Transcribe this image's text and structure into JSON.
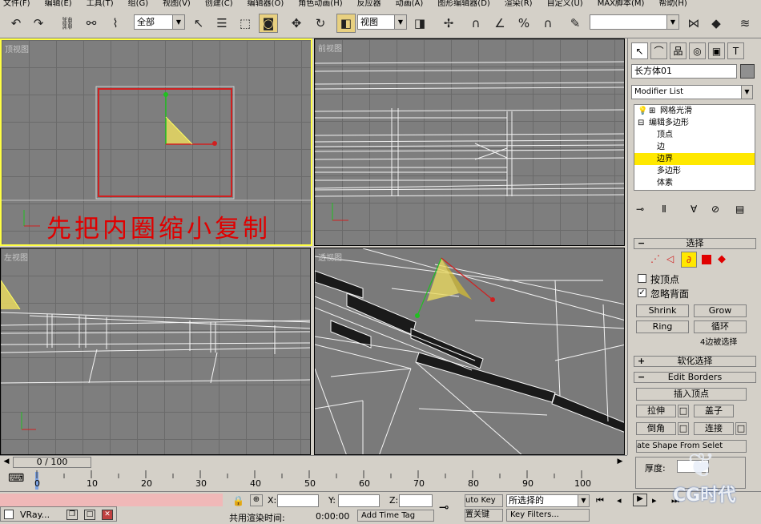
{
  "menu": [
    "文件(F)",
    "编辑(E)",
    "工具(T)",
    "组(G)",
    "视图(V)",
    "创建(C)",
    "编辑器(O)",
    "角色动画(H)",
    "反应器",
    "动画(A)",
    "图形编辑器(D)",
    "渲染(R)",
    "自定义(U)",
    "MAX脚本(M)",
    "帮助(H)"
  ],
  "toolbar": {
    "selection_filter": "全部",
    "ref_coord": "视图",
    "named_selection": ""
  },
  "viewports": {
    "top": {
      "label": "顶视图",
      "annotation": "先把内圈缩小复制"
    },
    "front": {
      "label": "前视图"
    },
    "left": {
      "label": "左视图"
    },
    "persp": {
      "label": "透视图"
    }
  },
  "command_panel": {
    "object_name": "长方体01",
    "modifier_list": "Modifier List",
    "stack": [
      "网格光滑",
      "编辑多边形",
      "顶点",
      "边",
      "边界",
      "多边形",
      "体素"
    ],
    "selection_rollout": "选择",
    "by_vertex": "按顶点",
    "ignore_backfacing": "忽略背面",
    "shrink": "Shrink",
    "grow": "Grow",
    "ring": "Ring",
    "loop": "循环",
    "sel_info": "4边被选择",
    "soft_selection": "软化选择",
    "edit_borders": "Edit Borders",
    "insert_vertex": "插入顶点",
    "extrude": "拉伸",
    "cap": "盖子",
    "chamfer": "倒角",
    "connect": "连接",
    "create_shape": "ate Shape From Selet",
    "thickness": "厚度:"
  },
  "timeline": {
    "frame": "0 / 100",
    "ticks": [
      "0",
      "10",
      "20",
      "30",
      "40",
      "50",
      "60",
      "70",
      "80",
      "90",
      "100"
    ]
  },
  "status": {
    "x_label": "X:",
    "y_label": "Y:",
    "z_label": "Z:",
    "render_time": "共用渲染时间:",
    "render_value": "0:00:00",
    "add_time_tag": "Add Time Tag",
    "auto_key": "uto Key",
    "set_key": "置关键",
    "selected": "所选择的",
    "key_filters": "Key Filters...",
    "taskbar_app": "VRay...",
    "watermark": "CG时代"
  },
  "colors": {
    "active_viewport": "#ffff44",
    "stack_selected": "#ffe800",
    "annotation": "#e00000"
  }
}
